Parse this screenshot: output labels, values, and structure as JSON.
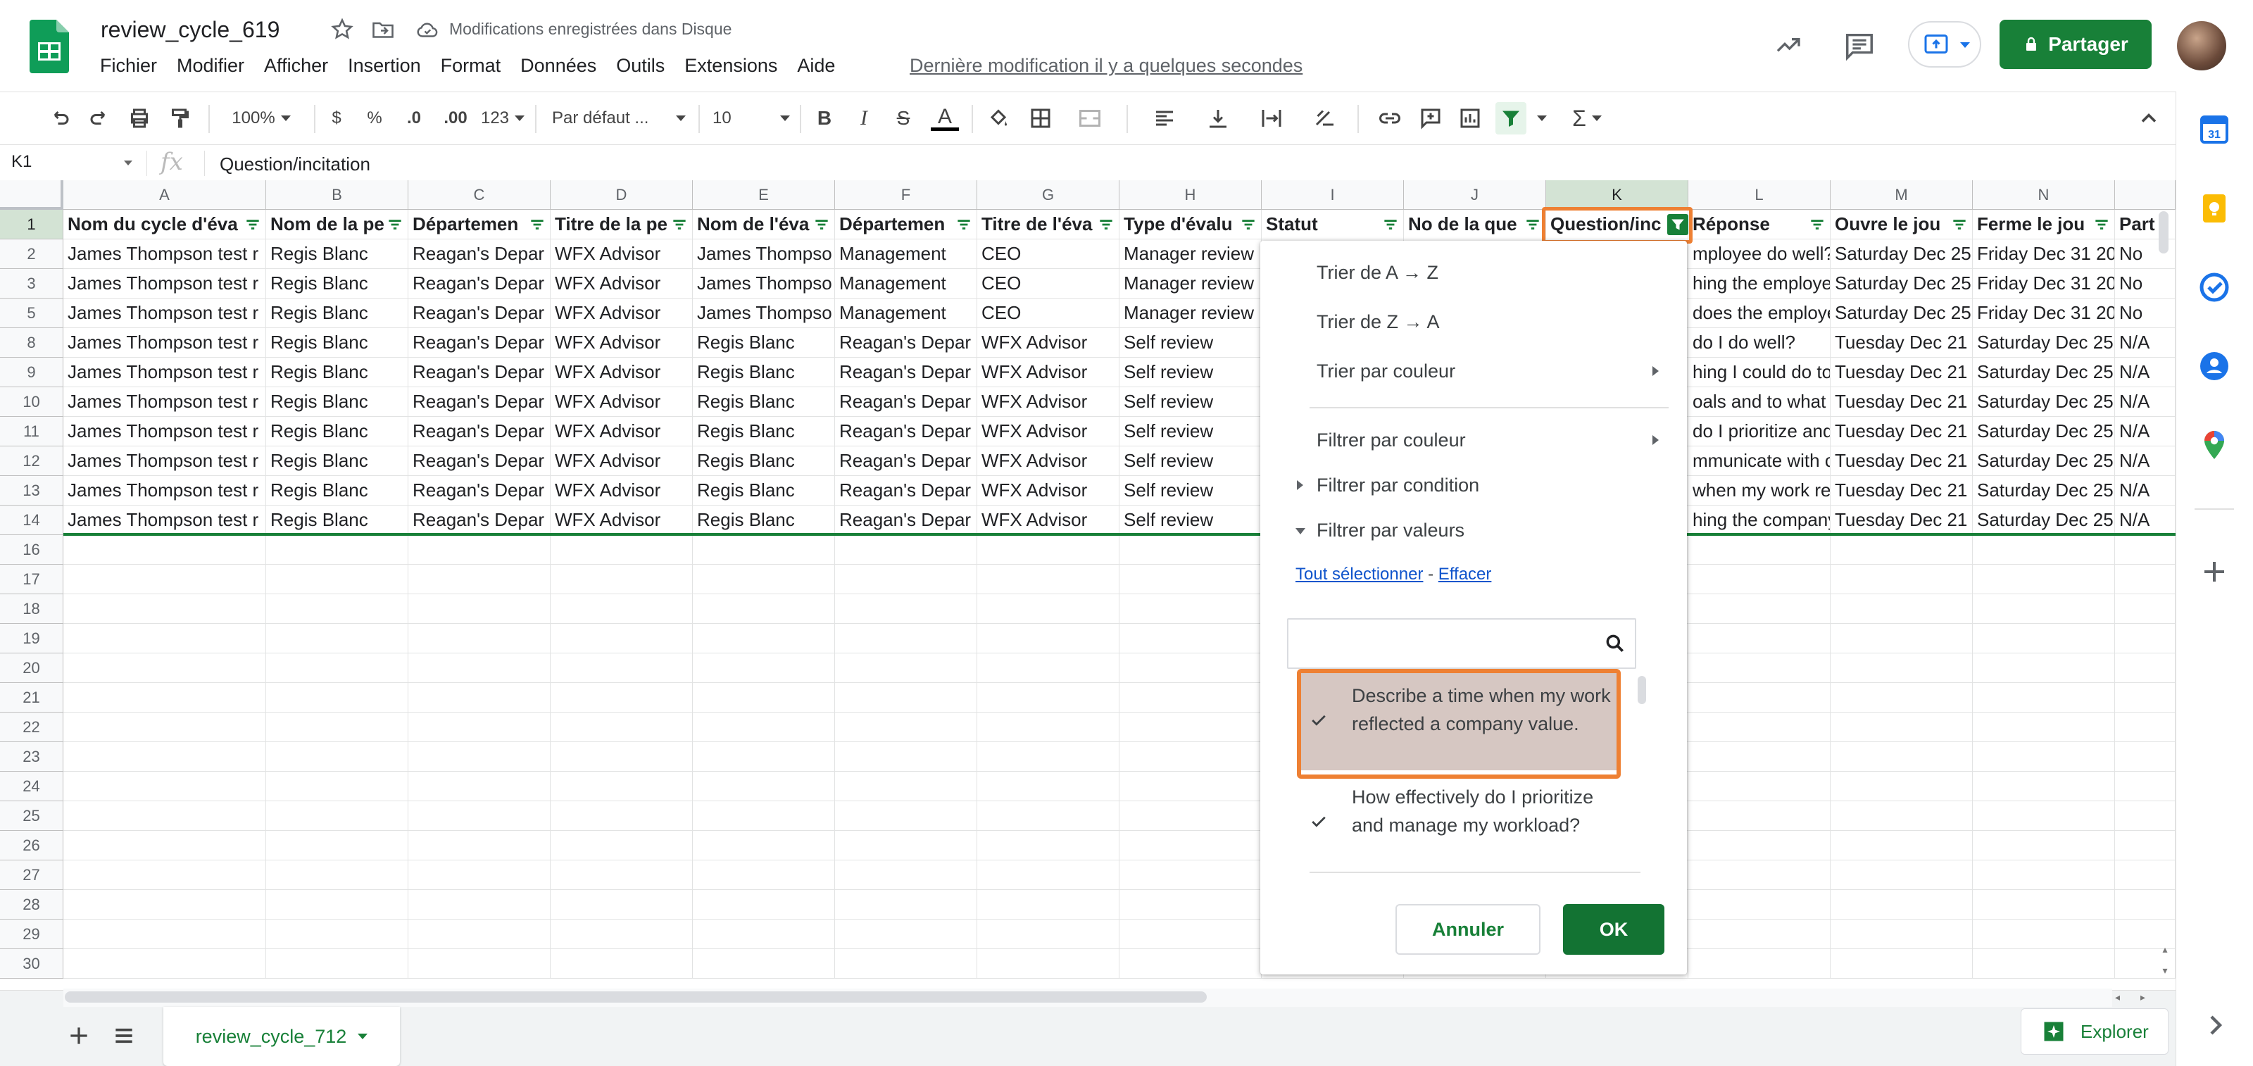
{
  "doc": {
    "title": "review_cycle_619",
    "save_status": "Modifications enregistrées dans Disque",
    "last_edit": "Dernière modification il y a quelques secondes"
  },
  "menu": [
    "Fichier",
    "Modifier",
    "Afficher",
    "Insertion",
    "Format",
    "Données",
    "Outils",
    "Extensions",
    "Aide"
  ],
  "header_actions": {
    "share_label": "Partager"
  },
  "toolbar": {
    "zoom": "100%",
    "currency": "$",
    "percent": "%",
    "dec_decrease": ".0",
    "dec_increase": ".00",
    "more_formats": "123",
    "font": "Par défaut ...",
    "font_size": "10"
  },
  "formula_bar": {
    "cell_ref": "K1",
    "fx": "fx",
    "content": "Question/incitation"
  },
  "grid": {
    "columns": [
      "A",
      "B",
      "C",
      "D",
      "E",
      "F",
      "G",
      "H",
      "I",
      "J",
      "K",
      "L",
      "M",
      "N",
      ""
    ],
    "selected_column": "K",
    "header_row": [
      "Nom du cycle d'éva",
      "Nom de la pe",
      "Départemen",
      "Titre de la pe",
      "Nom de l'éva",
      "Départemen",
      "Titre de l'éva",
      "Type d'évalu",
      "Statut",
      "No de la que",
      "Question/inc",
      "Réponse",
      "Ouvre le jou",
      "Ferme le jou",
      "Part"
    ],
    "rows": [
      {
        "num": "2",
        "cells": [
          "James Thompson test r",
          "Regis Blanc",
          "Reagan's Depar",
          "WFX Advisor",
          "James Thompso",
          "Management",
          "CEO",
          "Manager review",
          "",
          "",
          "",
          "mployee do well?",
          "Saturday Dec 25",
          "Friday Dec 31 20",
          "No"
        ]
      },
      {
        "num": "3",
        "cells": [
          "James Thompson test r",
          "Regis Blanc",
          "Reagan's Depar",
          "WFX Advisor",
          "James Thompso",
          "Management",
          "CEO",
          "Manager review",
          "",
          "",
          "",
          "hing the employe",
          "Saturday Dec 25",
          "Friday Dec 31 20",
          "No"
        ]
      },
      {
        "num": "5",
        "cells": [
          "James Thompson test r",
          "Regis Blanc",
          "Reagan's Depar",
          "WFX Advisor",
          "James Thompso",
          "Management",
          "CEO",
          "Manager review",
          "",
          "",
          "",
          "does the employe",
          "Saturday Dec 25",
          "Friday Dec 31 20",
          "No"
        ]
      },
      {
        "num": "8",
        "cells": [
          "James Thompson test r",
          "Regis Blanc",
          "Reagan's Depar",
          "WFX Advisor",
          "Regis Blanc",
          "Reagan's Depar",
          "WFX Advisor",
          "Self review",
          "",
          "",
          "",
          "do I do well?",
          "Tuesday Dec 21",
          "Saturday Dec 25",
          "N/A"
        ]
      },
      {
        "num": "9",
        "cells": [
          "James Thompson test r",
          "Regis Blanc",
          "Reagan's Depar",
          "WFX Advisor",
          "Regis Blanc",
          "Reagan's Depar",
          "WFX Advisor",
          "Self review",
          "",
          "",
          "",
          "hing I could do to",
          "Tuesday Dec 21",
          "Saturday Dec 25",
          "N/A"
        ]
      },
      {
        "num": "10",
        "cells": [
          "James Thompson test r",
          "Regis Blanc",
          "Reagan's Depar",
          "WFX Advisor",
          "Regis Blanc",
          "Reagan's Depar",
          "WFX Advisor",
          "Self review",
          "",
          "",
          "",
          "oals and to what",
          "Tuesday Dec 21",
          "Saturday Dec 25",
          "N/A"
        ]
      },
      {
        "num": "11",
        "cells": [
          "James Thompson test r",
          "Regis Blanc",
          "Reagan's Depar",
          "WFX Advisor",
          "Regis Blanc",
          "Reagan's Depar",
          "WFX Advisor",
          "Self review",
          "",
          "",
          "",
          "do I prioritize and",
          "Tuesday Dec 21",
          "Saturday Dec 25",
          "N/A"
        ]
      },
      {
        "num": "12",
        "cells": [
          "James Thompson test r",
          "Regis Blanc",
          "Reagan's Depar",
          "WFX Advisor",
          "Regis Blanc",
          "Reagan's Depar",
          "WFX Advisor",
          "Self review",
          "",
          "",
          "",
          "mmunicate with c",
          "Tuesday Dec 21",
          "Saturday Dec 25",
          "N/A"
        ]
      },
      {
        "num": "13",
        "cells": [
          "James Thompson test r",
          "Regis Blanc",
          "Reagan's Depar",
          "WFX Advisor",
          "Regis Blanc",
          "Reagan's Depar",
          "WFX Advisor",
          "Self review",
          "",
          "",
          "",
          "when my work ref",
          "Tuesday Dec 21",
          "Saturday Dec 25",
          "N/A"
        ]
      },
      {
        "num": "14",
        "cells": [
          "James Thompson test r",
          "Regis Blanc",
          "Reagan's Depar",
          "WFX Advisor",
          "Regis Blanc",
          "Reagan's Depar",
          "WFX Advisor",
          "Self review",
          "",
          "",
          "",
          "hing the company",
          "Tuesday Dec 21",
          "Saturday Dec 25",
          "N/A"
        ]
      }
    ],
    "empty_rows": [
      "16",
      "17",
      "18",
      "19",
      "20",
      "21",
      "22",
      "23",
      "24",
      "25",
      "26",
      "27",
      "28",
      "29",
      "30"
    ]
  },
  "filter_menu": {
    "sort_az": "Trier de A → Z",
    "sort_za": "Trier de Z → A",
    "sort_color": "Trier par couleur",
    "filter_color": "Filtrer par couleur",
    "filter_condition": "Filtrer par condition",
    "filter_values": "Filtrer par valeurs",
    "select_all": "Tout sélectionner",
    "link_sep": " - ",
    "clear": "Effacer",
    "search_value": "",
    "options": [
      {
        "label": "Describe a time when my work reflected a company value.",
        "checked": true
      },
      {
        "label": "How effectively do I prioritize and manage my workload?",
        "checked": true
      }
    ],
    "cancel": "Annuler",
    "ok": "OK"
  },
  "sheet_tab": {
    "name": "review_cycle_712"
  },
  "explore_label": "Explorer",
  "colors": {
    "accent": "#188038",
    "highlight": "#ee8033",
    "selected_bg": "#d6c7c2"
  }
}
